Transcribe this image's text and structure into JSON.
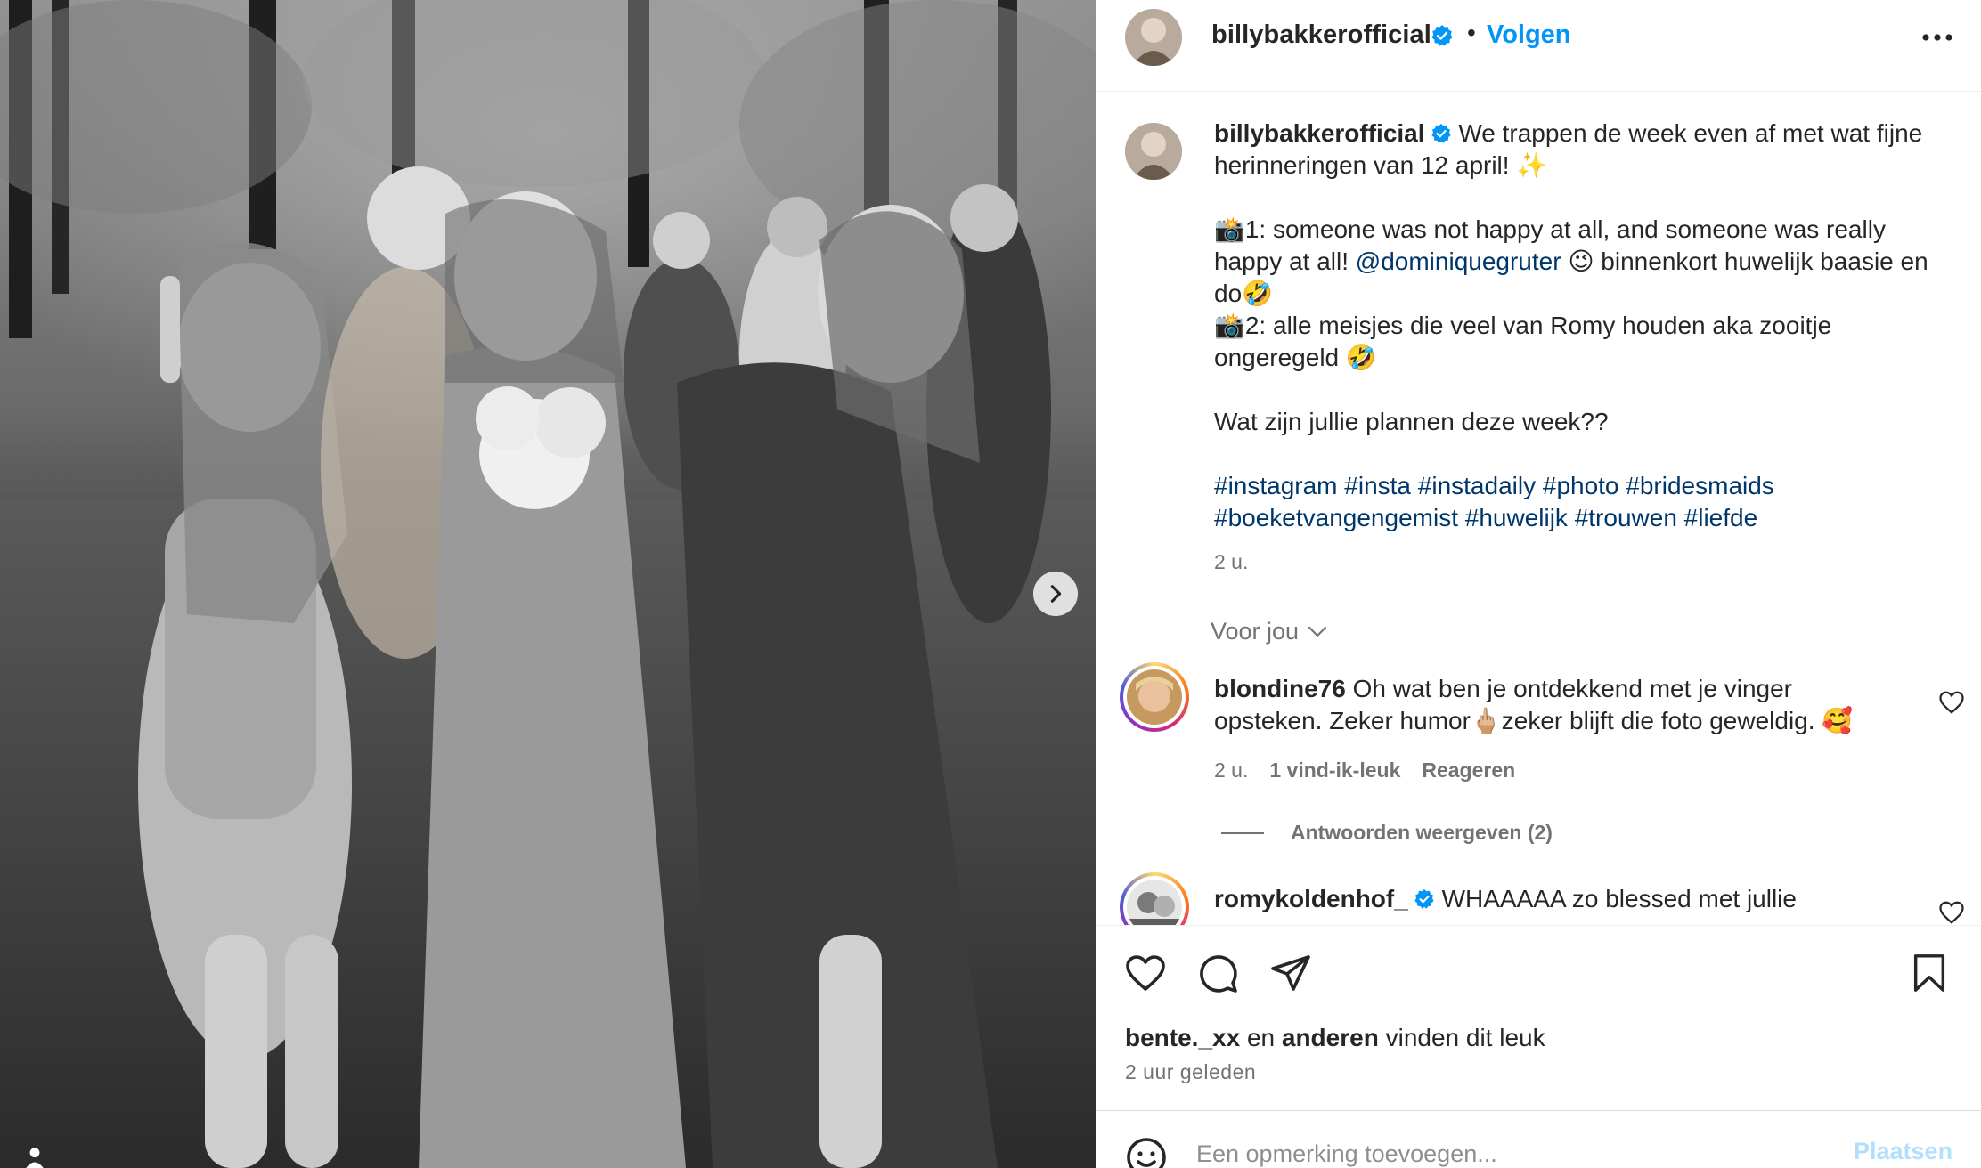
{
  "header": {
    "username": "billybakkerofficial",
    "separator": "•",
    "follow_label": "Volgen"
  },
  "caption": {
    "username": "billybakkerofficial",
    "line1": " We trappen de week even af met wat fijne herinneringen van 12 april! ✨",
    "line2a": "📸1: someone was not happy at all, and someone was really happy at all! ",
    "mention": "@dominiquegruter",
    "line2b": " 😉 binnenkort huwelijk baasie en do🤣",
    "line3": "📸2: alle meisjes die veel van Romy houden aka zooitje ongeregeld 🤣",
    "line4": "Wat zijn jullie plannen deze week??",
    "hashtags": "#instagram #insta #instadaily #photo #bridesmaids #boeketvangengemist #huwelijk #trouwen #liefde",
    "time": "2 u."
  },
  "foryou_label": "Voor jou",
  "comments": [
    {
      "username": "blondine76",
      "text": " Oh wat ben je ontdekkend met je vinger opsteken. Zeker humor🖕🏼zeker blijft die foto geweldig. 🥰",
      "time": "2 u.",
      "likes": "1 vind-ik-leuk",
      "reply_label": "Reageren",
      "view_replies": "Antwoorden weergeven (2)"
    },
    {
      "username": "romykoldenhof_",
      "text": " WHAAAAA zo blessed met jullie"
    }
  ],
  "likes": {
    "first_user": "bente._xx",
    "connector": " en ",
    "others": "anderen",
    "suffix": " vinden dit leuk"
  },
  "posted_ago": "2 uur geleden",
  "add_comment": {
    "placeholder": "Een opmerking toevoegen...",
    "post_label": "Plaatsen"
  },
  "colors": {
    "accent": "#0095f6",
    "link": "#00376b",
    "muted": "#737373",
    "verified": "#0095f6",
    "post_disabled": "#b2dffc"
  },
  "icons": {
    "verified": "verified-badge-icon",
    "more": "more-options-icon",
    "chevron": "chevron-down-icon",
    "like": "heart-icon",
    "comment": "comment-bubble-icon",
    "share": "paper-plane-icon",
    "save": "bookmark-icon",
    "emoji": "emoji-icon",
    "next": "chevron-right-icon",
    "tag": "user-tag-icon"
  }
}
